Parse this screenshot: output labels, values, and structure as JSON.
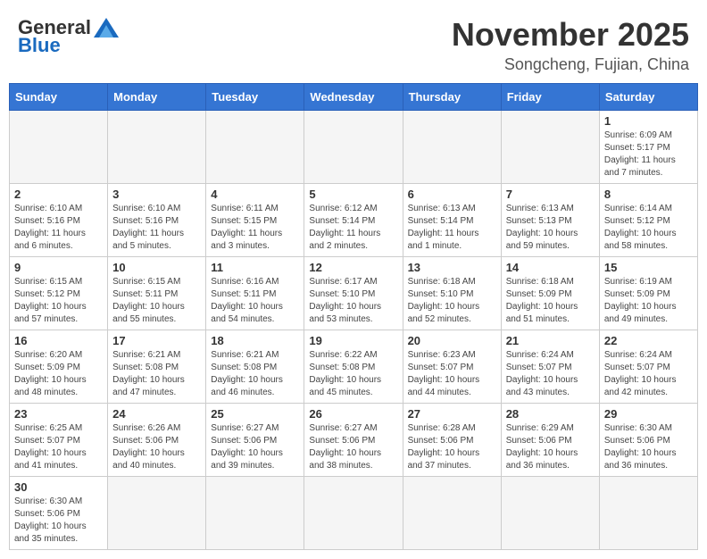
{
  "logo": {
    "general": "General",
    "blue": "Blue"
  },
  "title": {
    "month": "November 2025",
    "location": "Songcheng, Fujian, China"
  },
  "weekdays": [
    "Sunday",
    "Monday",
    "Tuesday",
    "Wednesday",
    "Thursday",
    "Friday",
    "Saturday"
  ],
  "weeks": [
    [
      {
        "day": null,
        "info": null
      },
      {
        "day": null,
        "info": null
      },
      {
        "day": null,
        "info": null
      },
      {
        "day": null,
        "info": null
      },
      {
        "day": null,
        "info": null
      },
      {
        "day": null,
        "info": null
      },
      {
        "day": "1",
        "info": "Sunrise: 6:09 AM\nSunset: 5:17 PM\nDaylight: 11 hours\nand 7 minutes."
      }
    ],
    [
      {
        "day": "2",
        "info": "Sunrise: 6:10 AM\nSunset: 5:16 PM\nDaylight: 11 hours\nand 6 minutes."
      },
      {
        "day": "3",
        "info": "Sunrise: 6:10 AM\nSunset: 5:16 PM\nDaylight: 11 hours\nand 5 minutes."
      },
      {
        "day": "4",
        "info": "Sunrise: 6:11 AM\nSunset: 5:15 PM\nDaylight: 11 hours\nand 3 minutes."
      },
      {
        "day": "5",
        "info": "Sunrise: 6:12 AM\nSunset: 5:14 PM\nDaylight: 11 hours\nand 2 minutes."
      },
      {
        "day": "6",
        "info": "Sunrise: 6:13 AM\nSunset: 5:14 PM\nDaylight: 11 hours\nand 1 minute."
      },
      {
        "day": "7",
        "info": "Sunrise: 6:13 AM\nSunset: 5:13 PM\nDaylight: 10 hours\nand 59 minutes."
      },
      {
        "day": "8",
        "info": "Sunrise: 6:14 AM\nSunset: 5:12 PM\nDaylight: 10 hours\nand 58 minutes."
      }
    ],
    [
      {
        "day": "9",
        "info": "Sunrise: 6:15 AM\nSunset: 5:12 PM\nDaylight: 10 hours\nand 57 minutes."
      },
      {
        "day": "10",
        "info": "Sunrise: 6:15 AM\nSunset: 5:11 PM\nDaylight: 10 hours\nand 55 minutes."
      },
      {
        "day": "11",
        "info": "Sunrise: 6:16 AM\nSunset: 5:11 PM\nDaylight: 10 hours\nand 54 minutes."
      },
      {
        "day": "12",
        "info": "Sunrise: 6:17 AM\nSunset: 5:10 PM\nDaylight: 10 hours\nand 53 minutes."
      },
      {
        "day": "13",
        "info": "Sunrise: 6:18 AM\nSunset: 5:10 PM\nDaylight: 10 hours\nand 52 minutes."
      },
      {
        "day": "14",
        "info": "Sunrise: 6:18 AM\nSunset: 5:09 PM\nDaylight: 10 hours\nand 51 minutes."
      },
      {
        "day": "15",
        "info": "Sunrise: 6:19 AM\nSunset: 5:09 PM\nDaylight: 10 hours\nand 49 minutes."
      }
    ],
    [
      {
        "day": "16",
        "info": "Sunrise: 6:20 AM\nSunset: 5:09 PM\nDaylight: 10 hours\nand 48 minutes."
      },
      {
        "day": "17",
        "info": "Sunrise: 6:21 AM\nSunset: 5:08 PM\nDaylight: 10 hours\nand 47 minutes."
      },
      {
        "day": "18",
        "info": "Sunrise: 6:21 AM\nSunset: 5:08 PM\nDaylight: 10 hours\nand 46 minutes."
      },
      {
        "day": "19",
        "info": "Sunrise: 6:22 AM\nSunset: 5:08 PM\nDaylight: 10 hours\nand 45 minutes."
      },
      {
        "day": "20",
        "info": "Sunrise: 6:23 AM\nSunset: 5:07 PM\nDaylight: 10 hours\nand 44 minutes."
      },
      {
        "day": "21",
        "info": "Sunrise: 6:24 AM\nSunset: 5:07 PM\nDaylight: 10 hours\nand 43 minutes."
      },
      {
        "day": "22",
        "info": "Sunrise: 6:24 AM\nSunset: 5:07 PM\nDaylight: 10 hours\nand 42 minutes."
      }
    ],
    [
      {
        "day": "23",
        "info": "Sunrise: 6:25 AM\nSunset: 5:07 PM\nDaylight: 10 hours\nand 41 minutes."
      },
      {
        "day": "24",
        "info": "Sunrise: 6:26 AM\nSunset: 5:06 PM\nDaylight: 10 hours\nand 40 minutes."
      },
      {
        "day": "25",
        "info": "Sunrise: 6:27 AM\nSunset: 5:06 PM\nDaylight: 10 hours\nand 39 minutes."
      },
      {
        "day": "26",
        "info": "Sunrise: 6:27 AM\nSunset: 5:06 PM\nDaylight: 10 hours\nand 38 minutes."
      },
      {
        "day": "27",
        "info": "Sunrise: 6:28 AM\nSunset: 5:06 PM\nDaylight: 10 hours\nand 37 minutes."
      },
      {
        "day": "28",
        "info": "Sunrise: 6:29 AM\nSunset: 5:06 PM\nDaylight: 10 hours\nand 36 minutes."
      },
      {
        "day": "29",
        "info": "Sunrise: 6:30 AM\nSunset: 5:06 PM\nDaylight: 10 hours\nand 36 minutes."
      }
    ],
    [
      {
        "day": "30",
        "info": "Sunrise: 6:30 AM\nSunset: 5:06 PM\nDaylight: 10 hours\nand 35 minutes."
      },
      {
        "day": null,
        "info": null
      },
      {
        "day": null,
        "info": null
      },
      {
        "day": null,
        "info": null
      },
      {
        "day": null,
        "info": null
      },
      {
        "day": null,
        "info": null
      },
      {
        "day": null,
        "info": null
      }
    ]
  ]
}
